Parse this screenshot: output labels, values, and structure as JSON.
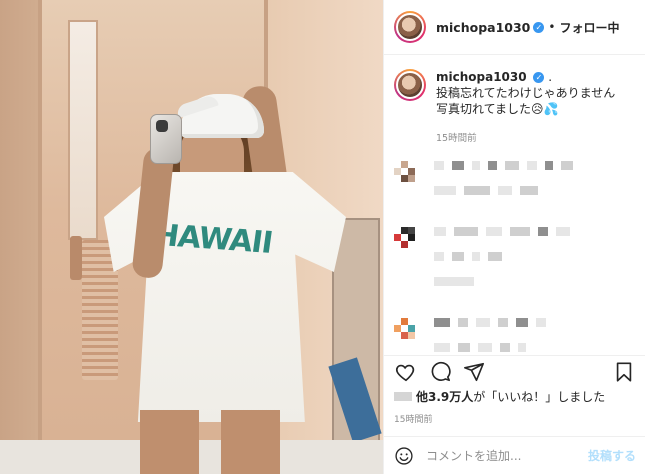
{
  "header": {
    "username": "michopa1030",
    "verified": "✓",
    "separator": "•",
    "follow_label": "フォロー中"
  },
  "caption": {
    "username": "michopa1030",
    "verified": "✓",
    "suffix": ".",
    "line1": "投稿忘れてたわけじゃありません",
    "line2": "写真切れてました😥💦",
    "time": "15時間前"
  },
  "likes": {
    "text_prefix": "他",
    "count": "3.9万人",
    "text_suffix": "が「いいね！」しました"
  },
  "post_time": "15時間前",
  "comment_input": {
    "placeholder": "コメントを追加..."
  },
  "post_button": "投稿する",
  "colors": {
    "accent_disabled": "#b2dffc",
    "verified_blue": "#3897f0",
    "shirt_print": "#2f8a7e"
  },
  "icons": [
    "heart-icon",
    "comment-icon",
    "share-icon",
    "bookmark-icon",
    "emoji-icon",
    "verified-icon"
  ]
}
